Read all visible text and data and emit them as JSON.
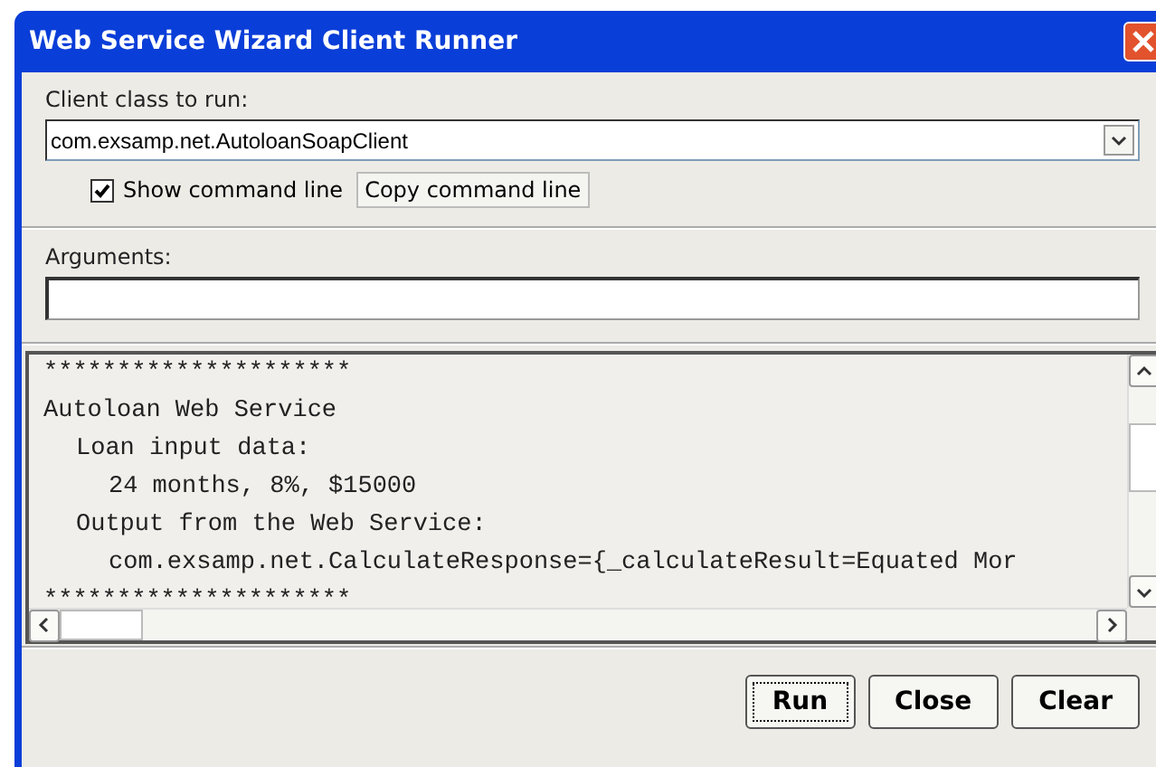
{
  "window": {
    "title": "Web Service Wizard Client Runner"
  },
  "client_class": {
    "label": "Client class to run:",
    "value": "com.exsamp.net.AutoloanSoapClient"
  },
  "show_command_line": {
    "label": "Show command line",
    "checked": true
  },
  "copy_button": "Copy command line",
  "arguments": {
    "label": "Arguments:"
  },
  "output": {
    "lines": [
      {
        "text": "*********************"
      },
      {
        "text": "Autoloan Web Service",
        "children": [
          {
            "text": "Loan input data:",
            "children": [
              {
                "text": "24 months, 8%, $15000"
              }
            ]
          },
          {
            "text": "Output from the Web Service:",
            "children": [
              {
                "text": "com.exsamp.net.CalculateResponse={_calculateResult=Equated Mor"
              }
            ]
          }
        ]
      },
      {
        "text": "*********************"
      }
    ]
  },
  "buttons": [
    {
      "label": "Run",
      "focused": true
    },
    {
      "label": "Close",
      "focused": false
    },
    {
      "label": "Clear",
      "focused": false
    }
  ]
}
